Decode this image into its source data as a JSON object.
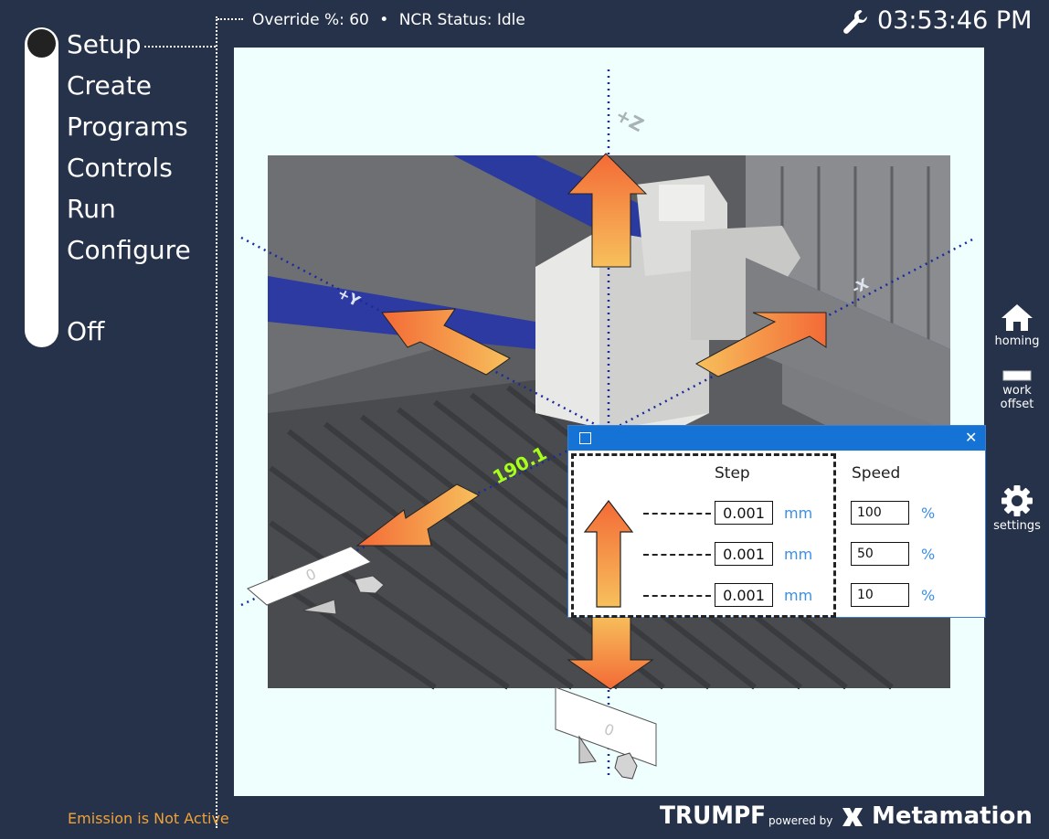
{
  "nav": {
    "items": [
      "Setup",
      "Create",
      "Programs",
      "Controls",
      "Run",
      "Configure"
    ],
    "off_label": "Off"
  },
  "status": {
    "override": "Override %: 60",
    "separator": "•",
    "ncr": "NCR Status: Idle"
  },
  "clock": "03:53:46 PM",
  "emission": "Emission is Not Active",
  "tools": {
    "homing": "homing",
    "work_offset": "work offset",
    "settings": "settings"
  },
  "scene": {
    "axis_plus_z": "+Z",
    "axis_plus_y": "+Y",
    "axis_minus_x": "-X",
    "readout": "190.1",
    "x_display": "0",
    "z_display": "0"
  },
  "dialog": {
    "close_glyph": "✕",
    "step_header": "Step",
    "speed_header": "Speed",
    "rows": [
      {
        "step": "0.001",
        "step_unit": "mm",
        "speed": "100",
        "speed_unit": "%"
      },
      {
        "step": "0.001",
        "step_unit": "mm",
        "speed": "50",
        "speed_unit": "%"
      },
      {
        "step": "0.001",
        "step_unit": "mm",
        "speed": "10",
        "speed_unit": "%"
      }
    ]
  },
  "brand": {
    "trumpf": "TRUMPF",
    "powered_by": "powered by",
    "metamation": "Metamation"
  },
  "colors": {
    "background": "#25324a",
    "viewport": "#effffe",
    "arrow_orange": "#f47a3a",
    "arrow_light": "#f7b55a",
    "emission_text": "#f0a23a",
    "dialog_title": "#1673d6",
    "unit_blue": "#3b8fe6"
  }
}
